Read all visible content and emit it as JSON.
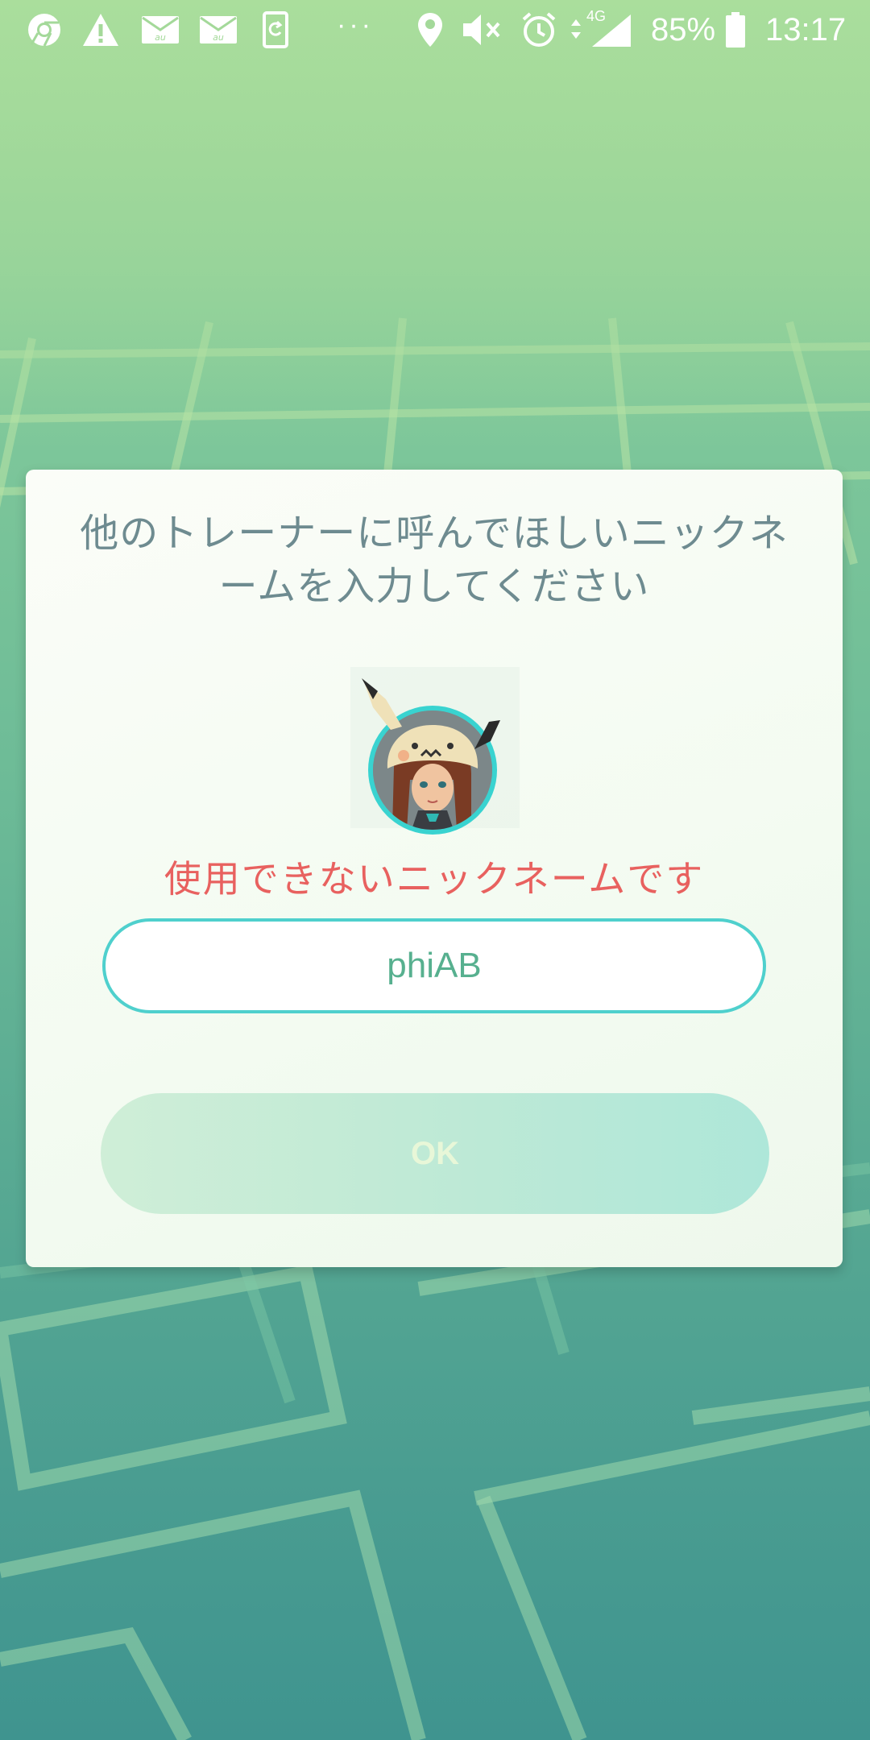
{
  "status_bar": {
    "battery": "85%",
    "time": "13:17",
    "network": "4G",
    "icons": [
      "chrome-icon",
      "warning-icon",
      "mail-icon",
      "mail-icon",
      "sync-icon",
      "more-icon",
      "location-icon",
      "mute-icon",
      "alarm-icon",
      "signal-icon",
      "battery-icon"
    ],
    "overflow": "···",
    "mail_label": "au"
  },
  "dialog": {
    "title": "他のトレーナーに呼んでほしいニックネームを入力してください",
    "error_message": "使用できないニックネームです",
    "nickname_value": "phiAB",
    "ok_label": "OK"
  },
  "colors": {
    "dialog_title": "#6e8b90",
    "error": "#e8615f",
    "input_border": "#4fd0cd",
    "input_text": "#57b08f",
    "avatar_ring": "#39d3d0"
  }
}
